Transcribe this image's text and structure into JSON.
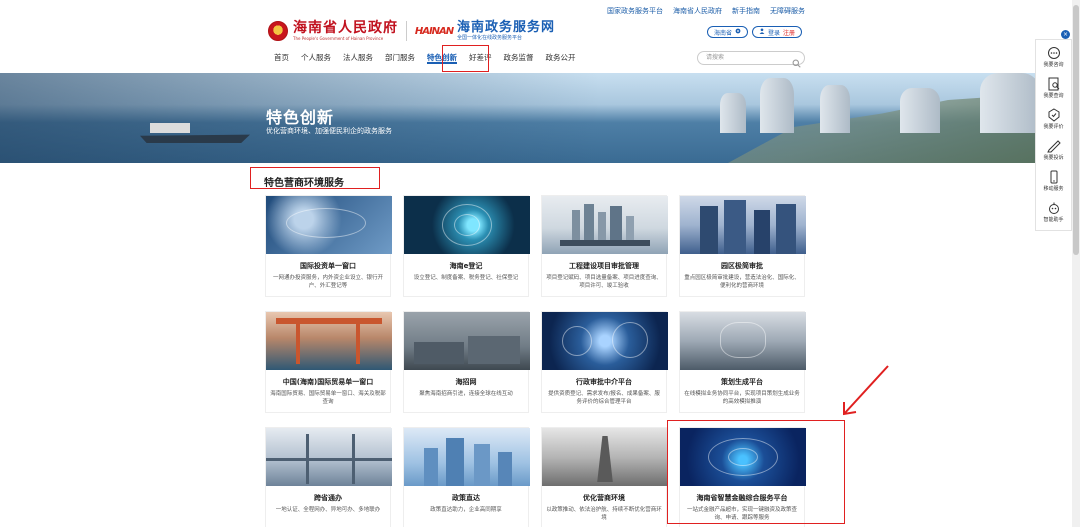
{
  "toplinks": [
    "国家政务服务平台",
    "海南省人民政府",
    "新手指南",
    "无障碍服务"
  ],
  "header": {
    "gov_name": "海南省人民政府",
    "gov_name_en": "The People's Government of Hainan Province",
    "hainan_logo": "HAINAN",
    "service_name": "海南政务服务网",
    "service_sub": "全国一体化在线政务服务平台",
    "region": "海南省",
    "login": "登录",
    "register": "注册"
  },
  "nav": {
    "items": [
      "首页",
      "个人服务",
      "法人服务",
      "部门服务",
      "特色创新",
      "好差评",
      "政务监督",
      "政务公开"
    ],
    "active_index": 4
  },
  "search": {
    "placeholder": "请搜索"
  },
  "banner": {
    "title": "特色创新",
    "subtitle": "优化营商环境、加强便民利企的政务服务"
  },
  "section": {
    "title": "特色营商环境服务"
  },
  "cards": [
    {
      "title": "国际投资单一窗口",
      "desc": "一网通办投资服务，内外资企业设立、银行开户、外汇登记等"
    },
    {
      "title": "海南e登记",
      "desc": "设立登记、制度备案、税务登记、社保登记"
    },
    {
      "title": "工程建设项目审批管理",
      "desc": "项目登记赋码、项目选量备案、项目进度查询、项目许可、竣工验收"
    },
    {
      "title": "园区极简审批",
      "desc": "重点园区极简审批建设，营造法治化、国际化、便利化的营商环境"
    },
    {
      "title": "中国(海南)国际贸易单一窗口",
      "desc": "海南国际贸易、国际贸易单一窗口、海关及税部查询"
    },
    {
      "title": "海招网",
      "desc": "聚焦海南招商引进，连接全球在线互动"
    },
    {
      "title": "行政审批中介平台",
      "desc": "提供资质登记、需求发布/报名、成果备案、服务评价的综合管理平台"
    },
    {
      "title": "策划生成平台",
      "desc": "在线模拟业务协同平台，实现项目策划生成业务的高效模拟推演"
    },
    {
      "title": "跨省通办",
      "desc": "一地认证、全程网办、异地可办、多地联办"
    },
    {
      "title": "政策直达",
      "desc": "政策直达助力，企业高同期享"
    },
    {
      "title": "优化营商环境",
      "desc": "以政策推动、依法治护航、持续不断优化营商环境"
    },
    {
      "title": "海南省智慧金融综合服务平台",
      "desc": "一站式金融产品超市，实现一键融资及政策查询、申请、跟踪等服务"
    }
  ],
  "sidebar": {
    "items": [
      {
        "label": "我要咨询",
        "icon": "chat-icon"
      },
      {
        "label": "我要查询",
        "icon": "query-icon"
      },
      {
        "label": "我要评价",
        "icon": "rating-icon"
      },
      {
        "label": "我要投诉",
        "icon": "complaint-icon"
      },
      {
        "label": "移动服务",
        "icon": "mobile-icon"
      },
      {
        "label": "智能助手",
        "icon": "assistant-icon"
      }
    ]
  }
}
